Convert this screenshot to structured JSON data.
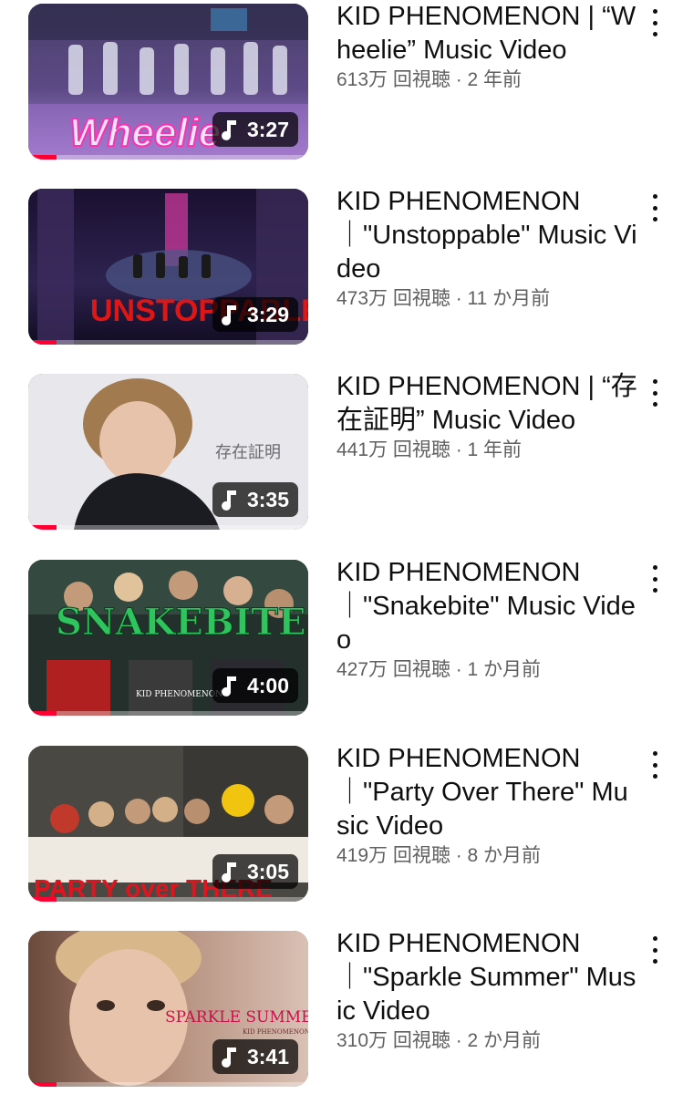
{
  "videos": [
    {
      "title": "KID PHENOMENON | “Wheelie” Music Video",
      "meta": "613万 回視聴 · 2 年前",
      "duration": "3:27",
      "progress": 0.1,
      "thumb_text": "Wheelie",
      "thumb_colors": [
        "#3a2c5c",
        "#7a5aa8",
        "#c7a6e8"
      ]
    },
    {
      "title": "KID PHENOMENON ｜\"Unstoppable\" Music Video",
      "meta": "473万 回視聴 · 11 か月前",
      "duration": "3:29",
      "progress": 0.1,
      "thumb_text": "UNSTOPPABLE",
      "thumb_colors": [
        "#0d0a1e",
        "#2b1d4d",
        "#5a3f8f"
      ]
    },
    {
      "title": "KID PHENOMENON | “存在証明” Music Video",
      "meta": "441万 回視聴 · 1 年前",
      "duration": "3:35",
      "progress": 0.1,
      "thumb_text": "存在証明",
      "thumb_colors": [
        "#e9e9ec",
        "#d9d7db",
        "#bdb9bf"
      ]
    },
    {
      "title": "KID PHENOMENON ｜\"Snakebite\" Music Video",
      "meta": "427万 回視聴 · 1 か月前",
      "duration": "4:00",
      "progress": 0.1,
      "thumb_text": "SNAKEBITE",
      "thumb_subtext": "KID PHENOMENON",
      "thumb_colors": [
        "#1e3b33",
        "#3b5e4e",
        "#7a2121"
      ]
    },
    {
      "title": "KID PHENOMENON ｜\"Party Over There\" Music Video",
      "meta": "419万 回視聴 · 8 か月前",
      "duration": "3:05",
      "progress": 0.1,
      "thumb_text": "PARTY over THERE",
      "thumb_colors": [
        "#3c3a36",
        "#8c8578",
        "#e8e4dc"
      ]
    },
    {
      "title": "KID PHENOMENON ｜\"Sparkle Summer\" Music Video",
      "meta": "310万 回視聴 · 2 か月前",
      "duration": "3:41",
      "progress": 0.1,
      "thumb_text": "SPARKLE SUMMER",
      "thumb_subtext": "KID PHENOMENON",
      "thumb_colors": [
        "#5a4038",
        "#b98e7a",
        "#e7cdbf"
      ]
    }
  ]
}
